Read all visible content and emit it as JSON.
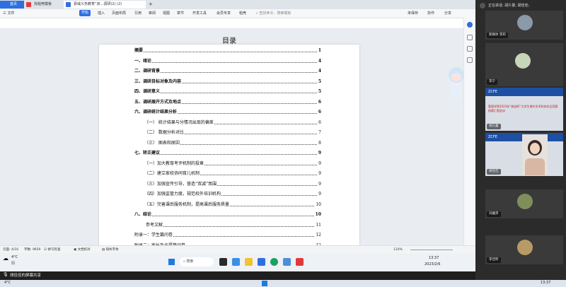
{
  "tabs": [
    {
      "label": "首页",
      "color": "#2f6fe0"
    },
    {
      "label": "找稻壳模板",
      "color": "#e03b3b"
    },
    {
      "label": "县域义务教育“双...调研(2) (2)",
      "color": "#2f6fe0"
    }
  ],
  "toolbar": {
    "items": [
      "三 文件",
      "开始",
      "插入",
      "页面布局",
      "引用",
      "审阅",
      "视图",
      "章节",
      "开发工具",
      "会员专享",
      "稻壳"
    ],
    "active": "开始",
    "search_placeholder": "查找命令、搜索模板",
    "right_items": [
      "未保存",
      "协作",
      "分享"
    ]
  },
  "document": {
    "heading": "目录",
    "entries": [
      {
        "text": "摘要",
        "page": "1",
        "bold": true
      },
      {
        "text": "一、绪论",
        "page": "4",
        "bold": true
      },
      {
        "text": "二、调研背景",
        "page": "4",
        "bold": true
      },
      {
        "text": "三、调研目标对象及内容",
        "page": "5",
        "bold": true
      },
      {
        "text": "四、调研意义",
        "page": "5",
        "bold": true
      },
      {
        "text": "五、调研展开方式及地点",
        "page": "6",
        "bold": true
      },
      {
        "text": "六、调研统计结果分析",
        "page": "6",
        "bold": true
      },
      {
        "text": "（一）  统计结果与分情况出现的偏差",
        "page": "6",
        "bold": false
      },
      {
        "text": "（二）   数据分析对比",
        "page": "7",
        "bold": false
      },
      {
        "text": "（三）   图表和原因",
        "page": "8",
        "bold": false
      },
      {
        "text": "七、矫正建议",
        "page": "9",
        "bold": true
      },
      {
        "text": "（一）加大教育考评机制的投章",
        "page": "9",
        "bold": false
      },
      {
        "text": "（二）建立家校协同育儿机制",
        "page": "9",
        "bold": false
      },
      {
        "text": "（三）加强宣传引导，营造“双减”氛围",
        "page": "9",
        "bold": false
      },
      {
        "text": "（四）加强监管力度，规范校外培训机构",
        "page": "9",
        "bold": false
      },
      {
        "text": "（五）完善课后服务机制，提高课后服务质量",
        "page": "10",
        "bold": false
      },
      {
        "text": "八、结论",
        "page": "10",
        "bold": true
      },
      {
        "text": "参考文献",
        "page": "11",
        "bold": false
      },
      {
        "text": "附录一：学生篇问卷",
        "page": "12",
        "bold": false
      },
      {
        "text": "附录二：家长及亲属篇问卷",
        "page": "12",
        "bold": false
      },
      {
        "text": "附录三：老师篇问卷",
        "page": "13",
        "bold": false
      }
    ]
  },
  "statusbar": {
    "page": "页面: 4/16",
    "words": "字数: 9659",
    "spell": "拼写检查",
    "proof": "文档校对",
    "missing_font": "缺失字体",
    "zoom": "110%"
  },
  "taskbar": {
    "weather_temp": "4°C",
    "weather_desc": "阴",
    "search_label": "搜索",
    "time": "13:37",
    "date": "2023/2/6"
  },
  "meeting": {
    "speaking": "正在讲话: 胡久蕾; 胡佳佳;",
    "participants": [
      {
        "name": "新媒体 李莉"
      },
      {
        "name": "李宁"
      },
      {
        "name": "胡久蕾"
      },
      {
        "name": "胡佳佳"
      },
      {
        "name": "刘雅萍"
      },
      {
        "name": "李佳昕"
      }
    ],
    "slide_title": "管理学院2023年“挑战杯”大学生课外学术科技作品竞赛校赛汇报会议",
    "slide_logo": "ZCFE"
  },
  "share_label": "胡佳佳的屏幕共享",
  "bottom": {
    "temp": "4°C",
    "time": "13:37"
  }
}
